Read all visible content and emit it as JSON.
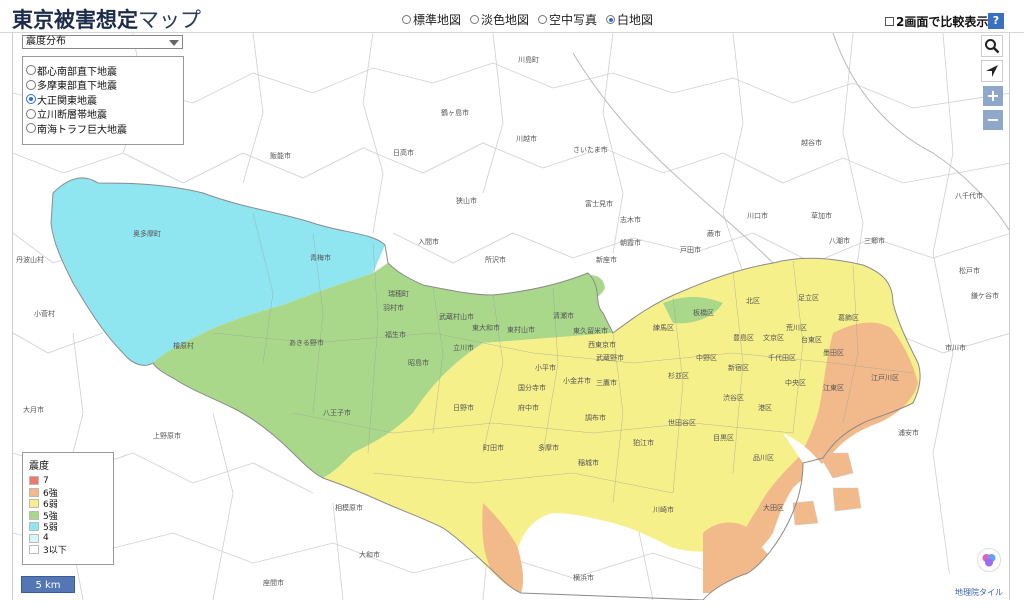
{
  "app": {
    "title": "東京被害想定",
    "title_suffix": "マップ"
  },
  "basemaps": [
    {
      "label": "標準地図",
      "selected": false
    },
    {
      "label": "淡色地図",
      "selected": false
    },
    {
      "label": "空中写真",
      "selected": false
    },
    {
      "label": "白地図",
      "selected": true
    }
  ],
  "compare": {
    "label": "2画面で比較表示",
    "checked": false
  },
  "help": {
    "label": "?"
  },
  "scenario": {
    "selected": "震度分布",
    "quakes": [
      {
        "label": "都心南部直下地震",
        "selected": false
      },
      {
        "label": "多摩東部直下地震",
        "selected": false
      },
      {
        "label": "大正関東地震",
        "selected": true
      },
      {
        "label": "立川断層帯地震",
        "selected": false
      },
      {
        "label": "南海トラフ巨大地震",
        "selected": false
      }
    ]
  },
  "legend": {
    "title": "震度",
    "items": [
      {
        "label": "7",
        "color": "#e87a6e"
      },
      {
        "label": "6強",
        "color": "#f2b98a"
      },
      {
        "label": "6弱",
        "color": "#f6f08a"
      },
      {
        "label": "5強",
        "color": "#a9d88b"
      },
      {
        "label": "5弱",
        "color": "#8fe6f0"
      },
      {
        "label": "4",
        "color": "#d9f6f7"
      },
      {
        "label": "3以下",
        "color": "#ffffff"
      }
    ]
  },
  "tools": {
    "zoom_in": "+",
    "zoom_out": "−"
  },
  "scale": {
    "label": "5 km"
  },
  "attribution": "地理院タイル",
  "towns": {
    "saitama": "さいたま市",
    "kawaguchi": "川口市",
    "toda": "戸田市",
    "warabi": "蕨市",
    "asaka": "朝霞市",
    "niiza": "新座市",
    "shiki": "志木市",
    "fujimi": "富士見市",
    "tokorozawa": "所沢市",
    "sayama": "狭山市",
    "iruma": "入間市",
    "hanno": "飯能市",
    "hidaka": "日高市",
    "kawagoe": "川越市",
    "tsurugashima": "鶴ヶ島市",
    "kawajima": "川島町",
    "matsudo": "松戸市",
    "ichikawa": "市川市",
    "yachiyo": "八千代市",
    "kamagaya": "鎌ケ谷市",
    "urayasu": "浦安市",
    "yashio": "八潮市",
    "soka": "草加市",
    "misato": "三郷市",
    "koshigaya": "越谷市",
    "sagamihara": "相模原市",
    "kawasaki": "川崎市",
    "yokohama": "横浜市",
    "yamato": "大和市",
    "zama": "座間市",
    "uenohara": "上野原市",
    "otsuki": "大月市",
    "kosuge": "小菅村",
    "tabayama": "丹波山村",
    "okutama": "奥多摩町",
    "hinohara": "檜原村",
    "ome": "青梅市",
    "akiruno": "あきる野市",
    "hachioji": "八王子市",
    "tachikawa": "立川市",
    "hino": "日野市",
    "fuchu": "府中市",
    "chofu": "調布市",
    "mitaka": "三鷹市",
    "musashino": "武蔵野市",
    "nerima": "練馬区",
    "setagaya": "世田谷区",
    "shinjuku": "新宿区",
    "chiyoda": "千代田区",
    "chuo": "中央区",
    "minato": "港区",
    "koto": "江東区",
    "edogawa": "江戸川区",
    "adachi": "足立区",
    "katsushika": "葛飾区",
    "machida": "町田市",
    "tama": "多摩市",
    "inagi": "稲城市",
    "kodaira": "小平市",
    "kokubunji": "国分寺市",
    "higashimurayama": "東村山市",
    "kiyose": "清瀬市",
    "higashikurume": "東久留米市",
    "nishitokyo": "西東京市",
    "koganei": "小金井市",
    "mizuho": "瑞穂町",
    "hamura": "羽村市",
    "fussa": "福生市",
    "akishima": "昭島市",
    "musashimurayama": "武蔵村山市",
    "higashiyamato": "東大和市",
    "suginami": "杉並区",
    "nakano": "中野区",
    "meguro": "目黒区",
    "ota": "大田区",
    "shinagawa": "品川区",
    "shibuya": "渋谷区",
    "itabashi": "板橋区",
    "kita": "北区",
    "arakawa": "荒川区",
    "sumida": "墨田区",
    "taito": "台東区",
    "bunkyo": "文京区",
    "toshima": "豊島区",
    "komae": "狛江市"
  }
}
